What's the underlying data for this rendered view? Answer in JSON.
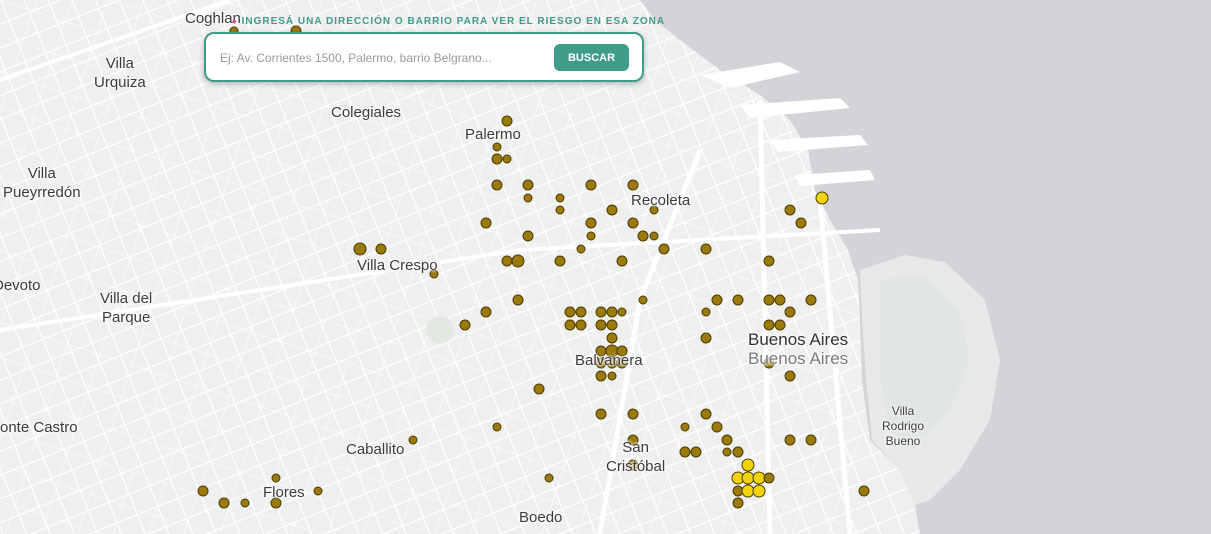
{
  "search": {
    "label": "Ingresá una dirección o barrio para ver el riesgo en esa zona",
    "placeholder": "Ej: Av. Corrientes 1500, Palermo, barrio Belgrano...",
    "value": "",
    "button_label": "BUSCAR",
    "pin_icon": "location-pin-icon"
  },
  "colors": {
    "accent": "#3e9c88",
    "pin": "#e0457b",
    "marker_low": "#9a7a0a",
    "marker_high": "#f2d40a",
    "water": "#d4d3d8",
    "land": "#efefef"
  },
  "places": [
    {
      "id": "coghlan",
      "name": "Coghlan"
    },
    {
      "id": "villa-urquiza",
      "name": "Villa\nUrquiza"
    },
    {
      "id": "colegiales",
      "name": "Colegiales"
    },
    {
      "id": "palermo",
      "name": "Palermo"
    },
    {
      "id": "villa-pueyrredon",
      "name": "Villa\nPueyrredón"
    },
    {
      "id": "recoleta",
      "name": "Recoleta"
    },
    {
      "id": "villa-crespo",
      "name": "Villa Crespo"
    },
    {
      "id": "devoto",
      "name": "Devoto"
    },
    {
      "id": "villa-del-parque",
      "name": "Villa del\nParque"
    },
    {
      "id": "buenos-aires",
      "name": "Buenos Aires"
    },
    {
      "id": "buenos-aires-2",
      "name": "Buenos Aires"
    },
    {
      "id": "balvanera",
      "name": "Balvanera"
    },
    {
      "id": "villa-rodrigo-bueno",
      "name": "Villa\nRodrigo\nBueno"
    },
    {
      "id": "monte-castro",
      "name": "onte Castro"
    },
    {
      "id": "caballito",
      "name": "Caballito"
    },
    {
      "id": "san-cristobal",
      "name": "San\nCristóbal"
    },
    {
      "id": "flores",
      "name": "Flores"
    },
    {
      "id": "boedo",
      "name": "Boedo"
    }
  ]
}
